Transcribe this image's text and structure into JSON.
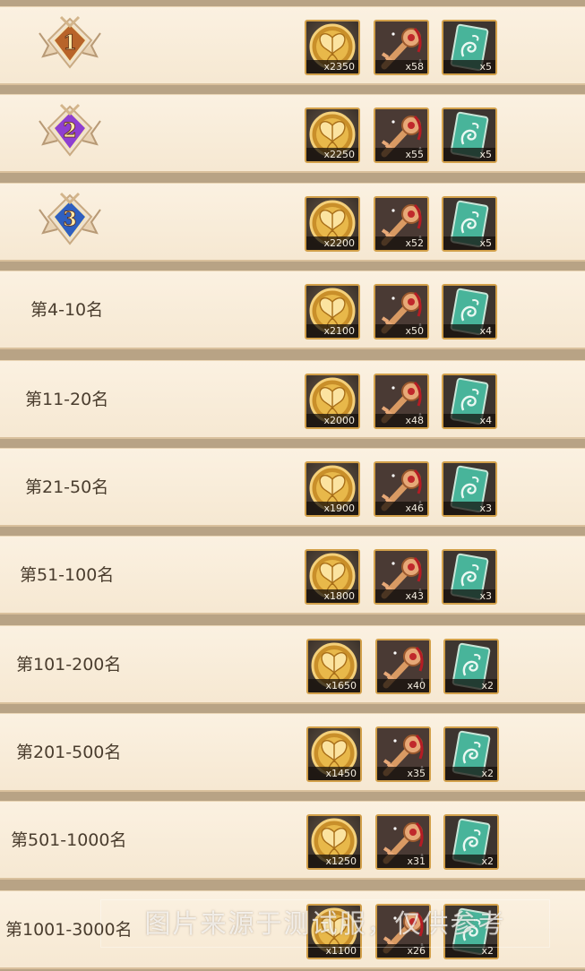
{
  "rewards": [
    {
      "rank": "1",
      "label": "",
      "items": [
        "x2350",
        "x58",
        "x5"
      ]
    },
    {
      "rank": "2",
      "label": "",
      "items": [
        "x2250",
        "x55",
        "x5"
      ]
    },
    {
      "rank": "3",
      "label": "",
      "items": [
        "x2200",
        "x52",
        "x5"
      ]
    },
    {
      "rank": "",
      "label": "第4-10名",
      "items": [
        "x2100",
        "x50",
        "x4"
      ]
    },
    {
      "rank": "",
      "label": "第11-20名",
      "items": [
        "x2000",
        "x48",
        "x4"
      ]
    },
    {
      "rank": "",
      "label": "第21-50名",
      "items": [
        "x1900",
        "x46",
        "x3"
      ]
    },
    {
      "rank": "",
      "label": "第51-100名",
      "items": [
        "x1800",
        "x43",
        "x3"
      ]
    },
    {
      "rank": "",
      "label": "第101-200名",
      "items": [
        "x1650",
        "x40",
        "x2"
      ]
    },
    {
      "rank": "",
      "label": "第201-500名",
      "items": [
        "x1450",
        "x35",
        "x2"
      ]
    },
    {
      "rank": "",
      "label": "第501-1000名",
      "items": [
        "x1250",
        "x31",
        "x2"
      ]
    },
    {
      "rank": "",
      "label": "第1001-3000名",
      "items": [
        "x1100",
        "x26",
        "x2"
      ]
    }
  ],
  "item_types": [
    "butterfly-coin-icon",
    "red-key-icon",
    "jade-dragon-card-icon"
  ],
  "medal_colors": {
    "1": "#b8642a",
    "2": "#8e3fd0",
    "3": "#2f5fbf"
  },
  "watermark": "图片来源于测试服，仅供参考"
}
